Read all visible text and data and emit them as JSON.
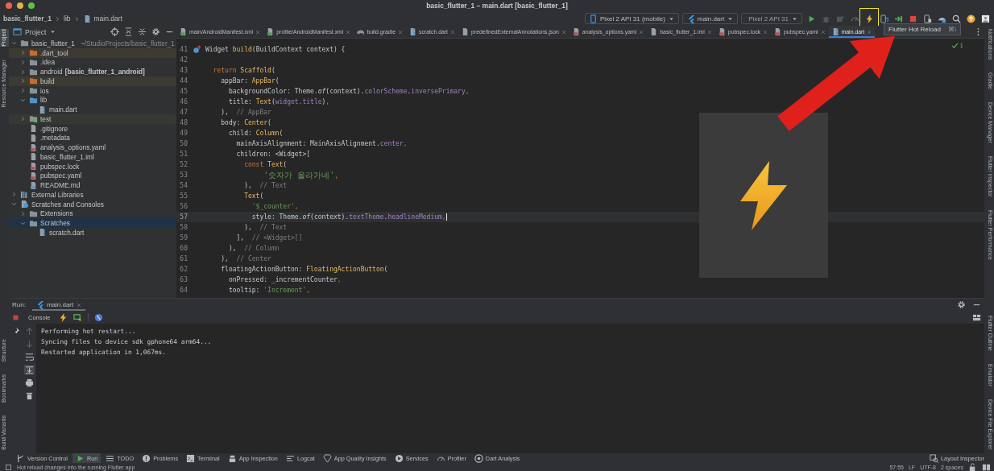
{
  "window": {
    "title": "basic_flutter_1 – main.dart [basic_flutter_1]"
  },
  "breadcrumbs": [
    {
      "label": "basic_flutter_1",
      "kind": "project"
    },
    {
      "label": "lib",
      "kind": "folder"
    },
    {
      "label": "main.dart",
      "kind": "file"
    }
  ],
  "run_toolbar": {
    "device": "Pixel 2 API 31 (mobile)",
    "configuration": "main.dart",
    "target": {
      "label": "Pixel 2 API 31",
      "disabled": true
    },
    "actions": [
      {
        "kind": "run",
        "disabled": false,
        "highlighted": false
      },
      {
        "kind": "debug",
        "disabled": true,
        "highlighted": false
      },
      {
        "kind": "attach",
        "disabled": true,
        "highlighted": false
      },
      {
        "kind": "profile",
        "disabled": true,
        "highlighted": false
      },
      {
        "kind": "hot-reload",
        "disabled": false,
        "highlighted": true
      },
      {
        "kind": "hot-restart",
        "disabled": false,
        "highlighted": false
      },
      {
        "kind": "apply",
        "disabled": false,
        "highlighted": false
      },
      {
        "kind": "stop",
        "disabled": false,
        "highlighted": false
      },
      {
        "kind": "device",
        "disabled": false,
        "highlighted": false
      },
      {
        "kind": "sdk",
        "disabled": false,
        "highlighted": false
      },
      {
        "kind": "search",
        "disabled": false,
        "highlighted": false
      },
      {
        "kind": "update",
        "disabled": false,
        "highlighted": false
      },
      {
        "kind": "account",
        "disabled": false,
        "highlighted": false
      }
    ]
  },
  "tooltip": {
    "text": "Flutter Hot Reload",
    "shortcut": "⌘\\"
  },
  "left_rail": {
    "top": [
      {
        "label": "Project",
        "selected": true
      },
      {
        "label": "Resource Manager",
        "selected": false
      }
    ],
    "bottom": [
      {
        "label": "Structure",
        "selected": false
      },
      {
        "label": "Bookmarks",
        "selected": false
      },
      {
        "label": "Build Variants",
        "selected": false
      }
    ]
  },
  "right_rail": {
    "top": [
      {
        "label": "Notifications",
        "selected": false
      },
      {
        "label": "Gradle",
        "selected": false
      },
      {
        "label": "Device Manager",
        "selected": false
      },
      {
        "label": "Flutter Inspector",
        "selected": false
      },
      {
        "label": "Flutter Performance",
        "selected": false
      }
    ],
    "bottom": [
      {
        "label": "Flutter Outline",
        "selected": false
      },
      {
        "label": "Emulator",
        "selected": false
      },
      {
        "label": "Device File Explorer",
        "selected": false
      }
    ]
  },
  "project": {
    "title": "Project",
    "tree": [
      {
        "label": "basic_flutter_1",
        "path": "~/StudioProjects/basic_flutter_1",
        "kind": "folder",
        "selected": false,
        "expanded": true,
        "children": [
          {
            "label": ".dart_tool",
            "kind": "folder-excluded",
            "selected": false,
            "expanded": false
          },
          {
            "label": ".idea",
            "kind": "folder",
            "selected": false,
            "expanded": false
          },
          {
            "label": "android",
            "module": "[basic_flutter_1_android]",
            "kind": "folder",
            "selected": false,
            "expanded": false
          },
          {
            "label": "build",
            "kind": "folder-excluded",
            "selected": false,
            "expanded": false
          },
          {
            "label": "ios",
            "kind": "folder",
            "selected": false,
            "expanded": false
          },
          {
            "label": "lib",
            "kind": "folder-source",
            "selected": false,
            "expanded": true,
            "children": [
              {
                "label": "main.dart",
                "kind": "dart-file",
                "selected": false
              }
            ]
          },
          {
            "label": "test",
            "kind": "folder-test",
            "selected": false,
            "expanded": false
          },
          {
            "label": ".gitignore",
            "kind": "file",
            "selected": false
          },
          {
            "label": ".metadata",
            "kind": "file",
            "selected": false
          },
          {
            "label": "analysis_options.yaml",
            "kind": "yaml-file",
            "selected": false
          },
          {
            "label": "basic_flutter_1.iml",
            "kind": "file",
            "selected": false
          },
          {
            "label": "pubspec.lock",
            "kind": "yaml-file",
            "selected": false
          },
          {
            "label": "pubspec.yaml",
            "kind": "yaml-file",
            "selected": false
          },
          {
            "label": "README.md",
            "kind": "md-file",
            "selected": false
          }
        ]
      },
      {
        "label": "External Libraries",
        "kind": "libraries",
        "selected": false,
        "expanded": false
      },
      {
        "label": "Scratches and Consoles",
        "kind": "scratches",
        "selected": false,
        "expanded": true,
        "children": [
          {
            "label": "Extensions",
            "kind": "folder",
            "selected": false,
            "expanded": false
          },
          {
            "label": "Scratches",
            "kind": "folder",
            "selected": true,
            "expanded": true,
            "children": [
              {
                "label": "scratch.dart",
                "kind": "dart-file",
                "selected": false
              }
            ]
          }
        ]
      }
    ]
  },
  "editor": {
    "tabs": [
      {
        "label": "main/AndroidManifest.xml",
        "kind": "xml-file",
        "selected": false
      },
      {
        "label": "profile/AndroidManifest.xml",
        "kind": "xml-file",
        "selected": false
      },
      {
        "label": "build.gradle",
        "kind": "gradle-file",
        "selected": false
      },
      {
        "label": "scratch.dart",
        "kind": "dart-file",
        "selected": false
      },
      {
        "label": "predefinedExternalAnnotations.json",
        "kind": "file",
        "selected": false
      },
      {
        "label": "analysis_options.yaml",
        "kind": "yaml-file",
        "selected": false
      },
      {
        "label": "basic_flutter_1.iml",
        "kind": "file",
        "selected": false
      },
      {
        "label": "pubspec.lock",
        "kind": "yaml-file",
        "selected": false
      },
      {
        "label": "pubspec.yaml",
        "kind": "yaml-file",
        "selected": false
      },
      {
        "label": "main.dart",
        "kind": "dart-file",
        "selected": true
      }
    ],
    "problems": "1",
    "lines": [
      {
        "number": "41",
        "override": true,
        "current": false,
        "tokens": [
          {
            "kind": "plain",
            "text": "Widget "
          },
          {
            "kind": "call",
            "text": "build"
          },
          {
            "kind": "plain",
            "text": "(BuildContext context) {"
          }
        ]
      },
      {
        "number": "42",
        "override": false,
        "current": false
      },
      {
        "number": "43",
        "override": false,
        "current": false,
        "tokens": [
          {
            "kind": "keyword",
            "text": "  return "
          },
          {
            "kind": "call",
            "text": "Scaffold"
          },
          {
            "kind": "plain",
            "text": "("
          }
        ]
      },
      {
        "number": "44",
        "override": false,
        "current": false,
        "tokens": [
          {
            "kind": "plain",
            "text": "    appBar: "
          },
          {
            "kind": "call",
            "text": "AppBar"
          },
          {
            "kind": "plain",
            "text": "("
          }
        ]
      },
      {
        "number": "45",
        "override": false,
        "current": false,
        "tokens": [
          {
            "kind": "plain",
            "text": "      backgroundColor: Theme."
          },
          {
            "kind": "static",
            "text": "of"
          },
          {
            "kind": "plain",
            "text": "(context)."
          },
          {
            "kind": "field",
            "text": "colorScheme"
          },
          {
            "kind": "plain",
            "text": "."
          },
          {
            "kind": "field",
            "text": "inversePrimary"
          },
          {
            "kind": "keyword",
            "text": ","
          }
        ]
      },
      {
        "number": "46",
        "override": false,
        "current": false,
        "tokens": [
          {
            "kind": "plain",
            "text": "      title: "
          },
          {
            "kind": "call",
            "text": "Text"
          },
          {
            "kind": "plain",
            "text": "("
          },
          {
            "kind": "field",
            "text": "widget.title"
          },
          {
            "kind": "plain",
            "text": ")"
          },
          {
            "kind": "keyword",
            "text": ","
          }
        ]
      },
      {
        "number": "47",
        "override": false,
        "current": false,
        "tokens": [
          {
            "kind": "plain",
            "text": "    ),"
          },
          {
            "kind": "hint",
            "text": "  // AppBar"
          }
        ]
      },
      {
        "number": "48",
        "override": false,
        "current": false,
        "tokens": [
          {
            "kind": "plain",
            "text": "    body: "
          },
          {
            "kind": "call",
            "text": "Center"
          },
          {
            "kind": "plain",
            "text": "("
          }
        ]
      },
      {
        "number": "49",
        "override": false,
        "current": false,
        "tokens": [
          {
            "kind": "plain",
            "text": "      child: "
          },
          {
            "kind": "call",
            "text": "Column"
          },
          {
            "kind": "plain",
            "text": "("
          }
        ]
      },
      {
        "number": "50",
        "override": false,
        "current": false,
        "tokens": [
          {
            "kind": "plain",
            "text": "        mainAxisAlignment: MainAxisAlignment."
          },
          {
            "kind": "field",
            "text": "center"
          },
          {
            "kind": "keyword",
            "text": ","
          }
        ]
      },
      {
        "number": "51",
        "override": false,
        "current": false,
        "tokens": [
          {
            "kind": "plain",
            "text": "        children: <Widget>["
          }
        ]
      },
      {
        "number": "52",
        "override": false,
        "current": false,
        "tokens": [
          {
            "kind": "keyword",
            "text": "          const "
          },
          {
            "kind": "call",
            "text": "Text"
          },
          {
            "kind": "plain",
            "text": "("
          }
        ]
      },
      {
        "number": "53",
        "override": false,
        "current": false,
        "tokens": [
          {
            "kind": "string-wide",
            "text": "            '숫자가 올라가네'"
          },
          {
            "kind": "keyword",
            "text": ","
          }
        ]
      },
      {
        "number": "54",
        "override": false,
        "current": false,
        "tokens": [
          {
            "kind": "plain",
            "text": "          ),"
          },
          {
            "kind": "hint",
            "text": "  // Text"
          }
        ]
      },
      {
        "number": "55",
        "override": false,
        "current": false,
        "tokens": [
          {
            "kind": "call",
            "text": "          Text"
          },
          {
            "kind": "plain",
            "text": "("
          }
        ]
      },
      {
        "number": "56",
        "override": false,
        "current": false,
        "tokens": [
          {
            "kind": "string",
            "text": "            '$_counter'"
          },
          {
            "kind": "keyword",
            "text": ","
          }
        ]
      },
      {
        "number": "57",
        "override": false,
        "current": true,
        "tokens": [
          {
            "kind": "plain",
            "text": "            style: Theme."
          },
          {
            "kind": "static",
            "text": "of"
          },
          {
            "kind": "plain",
            "text": "(context)."
          },
          {
            "kind": "field",
            "text": "textTheme"
          },
          {
            "kind": "plain",
            "text": "."
          },
          {
            "kind": "field",
            "text": "headlineMedium"
          },
          {
            "kind": "keyword",
            "text": ","
          }
        ]
      },
      {
        "number": "58",
        "override": false,
        "current": false,
        "tokens": [
          {
            "kind": "plain",
            "text": "          ),"
          },
          {
            "kind": "hint",
            "text": "  // Text"
          }
        ]
      },
      {
        "number": "59",
        "override": false,
        "current": false,
        "tokens": [
          {
            "kind": "plain",
            "text": "        ],"
          },
          {
            "kind": "hint",
            "text": "  // <Widget>[]"
          }
        ]
      },
      {
        "number": "60",
        "override": false,
        "current": false,
        "tokens": [
          {
            "kind": "plain",
            "text": "      ),"
          },
          {
            "kind": "hint",
            "text": "  // Column"
          }
        ]
      },
      {
        "number": "61",
        "override": false,
        "current": false,
        "tokens": [
          {
            "kind": "plain",
            "text": "    ),"
          },
          {
            "kind": "hint",
            "text": "  // Center"
          }
        ]
      },
      {
        "number": "62",
        "override": false,
        "current": false,
        "tokens": [
          {
            "kind": "plain",
            "text": "    floatingActionButton: "
          },
          {
            "kind": "call",
            "text": "FloatingActionButton"
          },
          {
            "kind": "plain",
            "text": "("
          }
        ]
      },
      {
        "number": "63",
        "override": false,
        "current": false,
        "tokens": [
          {
            "kind": "plain",
            "text": "      onPressed: _incrementCounter"
          },
          {
            "kind": "keyword",
            "text": ","
          }
        ]
      },
      {
        "number": "64",
        "override": false,
        "current": false,
        "tokens": [
          {
            "kind": "plain",
            "text": "      tooltip: "
          },
          {
            "kind": "string",
            "text": "'Increment'"
          },
          {
            "kind": "keyword",
            "text": ","
          }
        ]
      }
    ]
  },
  "run_panel": {
    "title": "Run:",
    "tabs": [
      {
        "label": "main.dart",
        "selected": true
      }
    ],
    "console_tab": "Console",
    "side_actions": [
      {
        "kind": "up",
        "selected": false
      },
      {
        "kind": "down",
        "selected": false
      },
      {
        "kind": "wrap",
        "selected": false
      },
      {
        "kind": "scroll-end",
        "selected": true
      },
      {
        "kind": "print",
        "selected": false
      },
      {
        "kind": "trash",
        "selected": false
      }
    ],
    "output": [
      "Performing hot restart...",
      "Syncing files to device sdk gphone64 arm64...",
      "Restarted application in 1,067ms."
    ]
  },
  "tool_windows": [
    {
      "label": "Version Control",
      "kind": "vcs",
      "selected": false
    },
    {
      "label": "Run",
      "kind": "run",
      "selected": true
    },
    {
      "label": "TODO",
      "kind": "todo",
      "selected": false
    },
    {
      "label": "Problems",
      "kind": "problems",
      "selected": false
    },
    {
      "label": "Terminal",
      "kind": "terminal",
      "selected": false
    },
    {
      "label": "App Inspection",
      "kind": "inspection",
      "selected": false
    },
    {
      "label": "Logcat",
      "kind": "logcat",
      "selected": false
    },
    {
      "label": "App Quality Insights",
      "kind": "quality",
      "selected": false
    },
    {
      "label": "Services",
      "kind": "services",
      "selected": false
    },
    {
      "label": "Profiler",
      "kind": "profile",
      "selected": false
    },
    {
      "label": "Dart Analysis",
      "kind": "dart-analysis",
      "selected": false
    }
  ],
  "layout_inspector": "Layout Inspector",
  "status_bar": {
    "message": "Hot reload changes into the running Flutter app",
    "position": "57:55",
    "line_separator": "LF",
    "encoding": "UTF-8",
    "indent": "2 spaces"
  }
}
